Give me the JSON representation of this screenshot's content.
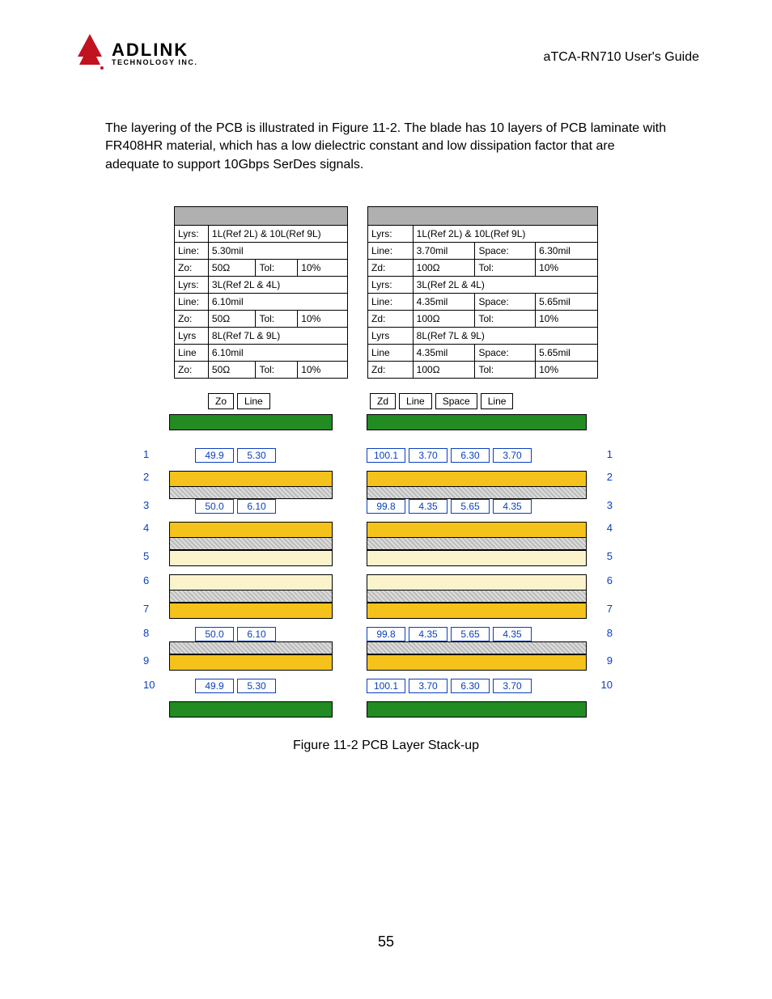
{
  "header": {
    "logo_main": "ADLINK",
    "logo_sub": "TECHNOLOGY INC.",
    "guide": "aTCA-RN710 User's Guide"
  },
  "paragraph": "The layering of the PCB is illustrated in Figure 11-2. The blade has 10 layers of PCB laminate with FR408HR material, which has a low dielectric constant and low dissipation factor that are adequate to support 10Gbps SerDes signals.",
  "left_spec": {
    "r1": [
      "Lyrs:",
      "1L(Ref 2L) & 10L(Ref 9L)",
      "",
      ""
    ],
    "r2": [
      "Line:",
      "5.30mil",
      "",
      ""
    ],
    "r3": [
      "Zo:",
      "50Ω",
      "Tol:",
      "10%"
    ],
    "r4": [
      "Lyrs:",
      "3L(Ref 2L & 4L)",
      "",
      ""
    ],
    "r5": [
      "Line:",
      "6.10mil",
      "",
      ""
    ],
    "r6": [
      "Zo:",
      "50Ω",
      "Tol:",
      "10%"
    ],
    "r7": [
      "Lyrs",
      "8L(Ref 7L & 9L)",
      "",
      ""
    ],
    "r8": [
      "Line",
      "6.10mil",
      "",
      ""
    ],
    "r9": [
      "Zo:",
      "50Ω",
      "Tol:",
      "10%"
    ]
  },
  "right_spec": {
    "r1": [
      "Lyrs:",
      "1L(Ref 2L) & 10L(Ref 9L)",
      "",
      ""
    ],
    "r2": [
      "Line:",
      "3.70mil",
      "Space:",
      "6.30mil"
    ],
    "r3": [
      "Zd:",
      "100Ω",
      "Tol:",
      "10%"
    ],
    "r4": [
      "Lyrs:",
      "3L(Ref 2L & 4L)",
      "",
      ""
    ],
    "r5": [
      "Line:",
      "4.35mil",
      "Space:",
      "5.65mil"
    ],
    "r6": [
      "Zd:",
      "100Ω",
      "Tol:",
      "10%"
    ],
    "r7": [
      "Lyrs",
      "8L(Ref 7L & 9L)",
      "",
      ""
    ],
    "r8": [
      "Line",
      "4.35mil",
      "Space:",
      "5.65mil"
    ],
    "r9": [
      "Zd:",
      "100Ω",
      "Tol:",
      "10%"
    ]
  },
  "left_labels": [
    "Zo",
    "Line"
  ],
  "right_labels": [
    "Zd",
    "Line",
    "Space",
    "Line"
  ],
  "layers": {
    "left": {
      "1": [
        "49.9",
        "5.30"
      ],
      "3": [
        "50.0",
        "6.10"
      ],
      "8": [
        "50.0",
        "6.10"
      ],
      "10": [
        "49.9",
        "5.30"
      ]
    },
    "right": {
      "1": [
        "100.1",
        "3.70",
        "6.30",
        "3.70"
      ],
      "3": [
        "99.8",
        "4.35",
        "5.65",
        "4.35"
      ],
      "8": [
        "99.8",
        "4.35",
        "5.65",
        "4.35"
      ],
      "10": [
        "100.1",
        "3.70",
        "6.30",
        "3.70"
      ]
    }
  },
  "layer_numbers": [
    "1",
    "2",
    "3",
    "4",
    "5",
    "6",
    "7",
    "8",
    "9",
    "10"
  ],
  "caption": "Figure 11-2 PCB Layer Stack-up",
  "page": "55"
}
